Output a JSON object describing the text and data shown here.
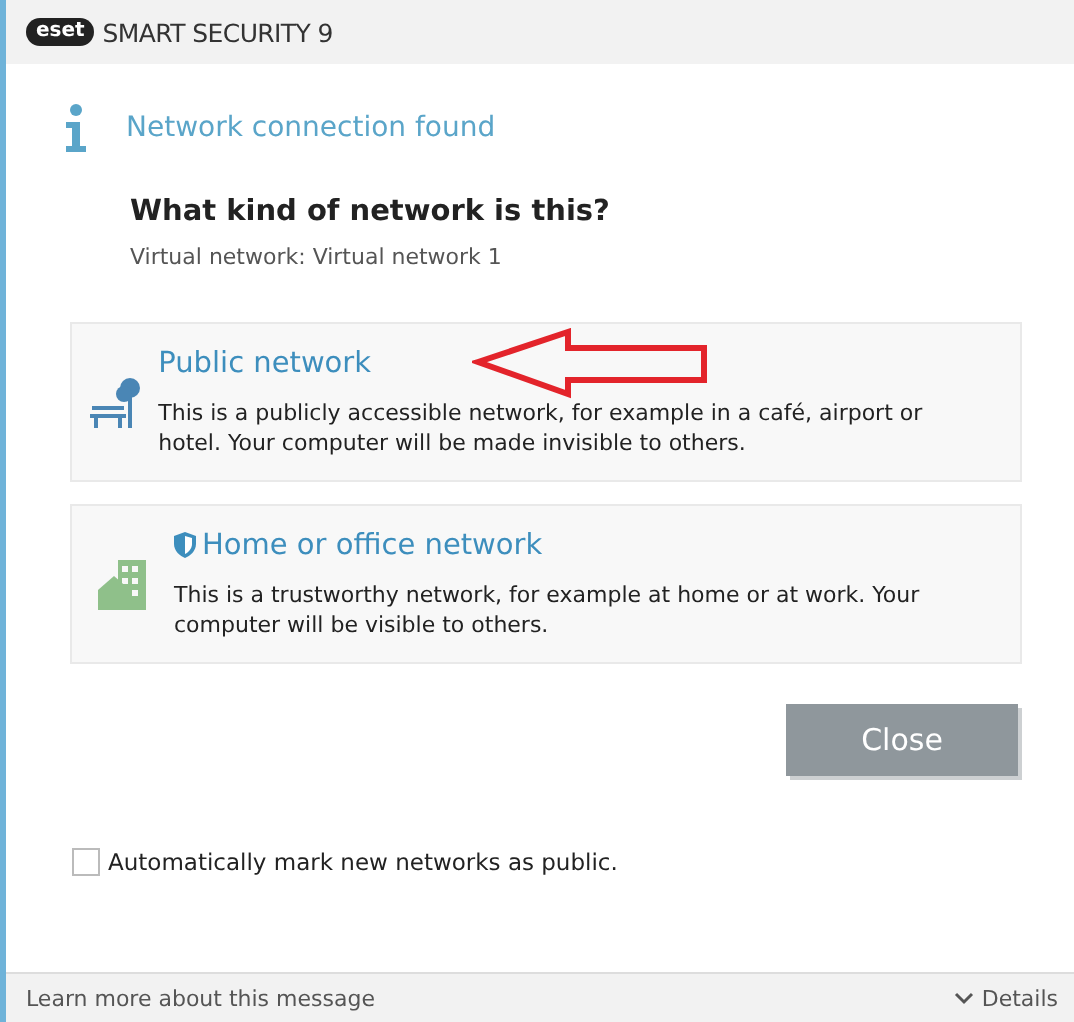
{
  "window": {
    "logo": "eset",
    "title": "SMART SECURITY 9"
  },
  "notice": {
    "title": "Network connection found"
  },
  "question": "What kind of network is this?",
  "network": "Virtual network: Virtual network 1",
  "options": [
    {
      "kind": "public",
      "title": "Public network",
      "description": "This is a publicly accessible network, for example in a café, airport or hotel. Your computer will be made invisible to others.",
      "pointed": true
    },
    {
      "kind": "home",
      "title": "Home or office network",
      "description": "This is a trustworthy network, for example at home or at work. Your computer will be visible to others.",
      "pointed": false
    }
  ],
  "close_button": "Close",
  "auto_mark": {
    "label": "Automatically mark new networks as public.",
    "checked": false
  },
  "footer": {
    "link": "Learn more about this message",
    "details": "Details"
  }
}
